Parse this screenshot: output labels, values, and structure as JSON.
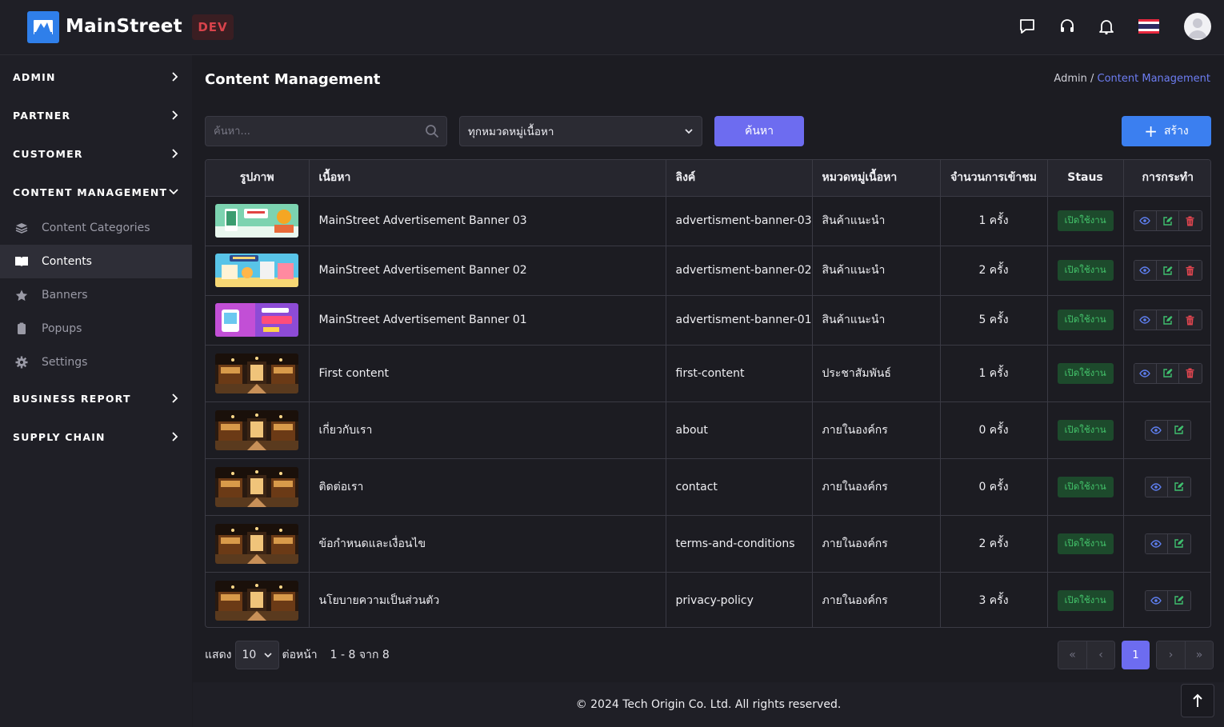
{
  "app": {
    "name": "MainStreet",
    "env": "DEV",
    "brand_color": "#2f7fea"
  },
  "topbar": {
    "icons": [
      "chat-icon",
      "headset-icon",
      "bell-icon",
      "thai-flag-icon",
      "avatar"
    ]
  },
  "sidebar": {
    "groups": [
      {
        "label": "ADMIN"
      },
      {
        "label": "PARTNER"
      },
      {
        "label": "CUSTOMER"
      },
      {
        "label": "CONTENT MANAGEMENT",
        "expanded": true,
        "items": [
          {
            "label": "Content Categories",
            "icon": "layers-icon"
          },
          {
            "label": "Contents",
            "icon": "book-icon",
            "active": true
          },
          {
            "label": "Banners",
            "icon": "star-icon"
          },
          {
            "label": "Popups",
            "icon": "clipboard-icon"
          },
          {
            "label": "Settings",
            "icon": "gear-icon"
          }
        ]
      },
      {
        "label": "BUSINESS REPORT"
      },
      {
        "label": "SUPPLY CHAIN"
      }
    ]
  },
  "page": {
    "title": "Content Management",
    "breadcrumb": {
      "parent": "Admin",
      "sep": " / ",
      "current": "Content Management"
    }
  },
  "filters": {
    "search_placeholder": "ค้นหา...",
    "category_value": "ทุกหมวดหมู่เนื้อหา",
    "search_button": "ค้นหา",
    "create_button": "สร้าง"
  },
  "table": {
    "headers": [
      "รูปภาพ",
      "เนื้อหา",
      "ลิงค์",
      "หมวดหมู่เนื้อหา",
      "จำนวนการเข้าชม",
      "Staus",
      "การกระทำ"
    ],
    "rows": [
      {
        "thumb": "banner-03",
        "title": "MainStreet Advertisement Banner 03",
        "link": "advertisment-banner-03",
        "category": "สินค้าแนะนำ",
        "views": "1 ครั้ง",
        "status": "เปิดใช้งาน",
        "deletable": true
      },
      {
        "thumb": "banner-02",
        "title": "MainStreet Advertisement Banner 02",
        "link": "advertisment-banner-02",
        "category": "สินค้าแนะนำ",
        "views": "2 ครั้ง",
        "status": "เปิดใช้งาน",
        "deletable": true
      },
      {
        "thumb": "banner-01",
        "title": "MainStreet Advertisement Banner 01",
        "link": "advertisment-banner-01",
        "category": "สินค้าแนะนำ",
        "views": "5 ครั้ง",
        "status": "เปิดใช้งาน",
        "deletable": true
      },
      {
        "thumb": "store",
        "title": "First content",
        "link": "first-content",
        "category": "ประชาสัมพันธ์",
        "views": "1 ครั้ง",
        "status": "เปิดใช้งาน",
        "deletable": true
      },
      {
        "thumb": "store",
        "title": "เกี่ยวกับเรา",
        "link": "about",
        "category": "ภายในองค์กร",
        "views": "0 ครั้ง",
        "status": "เปิดใช้งาน",
        "deletable": false
      },
      {
        "thumb": "store",
        "title": "ติดต่อเรา",
        "link": "contact",
        "category": "ภายในองค์กร",
        "views": "0 ครั้ง",
        "status": "เปิดใช้งาน",
        "deletable": false
      },
      {
        "thumb": "store",
        "title": "ข้อกำหนดและเงื่อนไข",
        "link": "terms-and-conditions",
        "category": "ภายในองค์กร",
        "views": "2 ครั้ง",
        "status": "เปิดใช้งาน",
        "deletable": false
      },
      {
        "thumb": "store",
        "title": "นโยบายความเป็นส่วนตัว",
        "link": "privacy-policy",
        "category": "ภายในองค์กร",
        "views": "3 ครั้ง",
        "status": "เปิดใช้งาน",
        "deletable": false
      }
    ]
  },
  "pagination": {
    "show_label": "แสดง",
    "page_size": "10",
    "per_page_label": "ต่อหน้า",
    "range_text": "1 - 8 จาก 8",
    "first": "«",
    "prev": "‹",
    "current": "1",
    "next": "›",
    "last": "»"
  },
  "footer": {
    "text": "© 2024 Tech Origin Co. Ltd. All rights reserved."
  },
  "colors": {
    "accent": "#6d6cf0",
    "create": "#3b7ff0",
    "status_bg": "#1d4a2c",
    "status_fg": "#43c26a",
    "danger": "#e0454f"
  }
}
